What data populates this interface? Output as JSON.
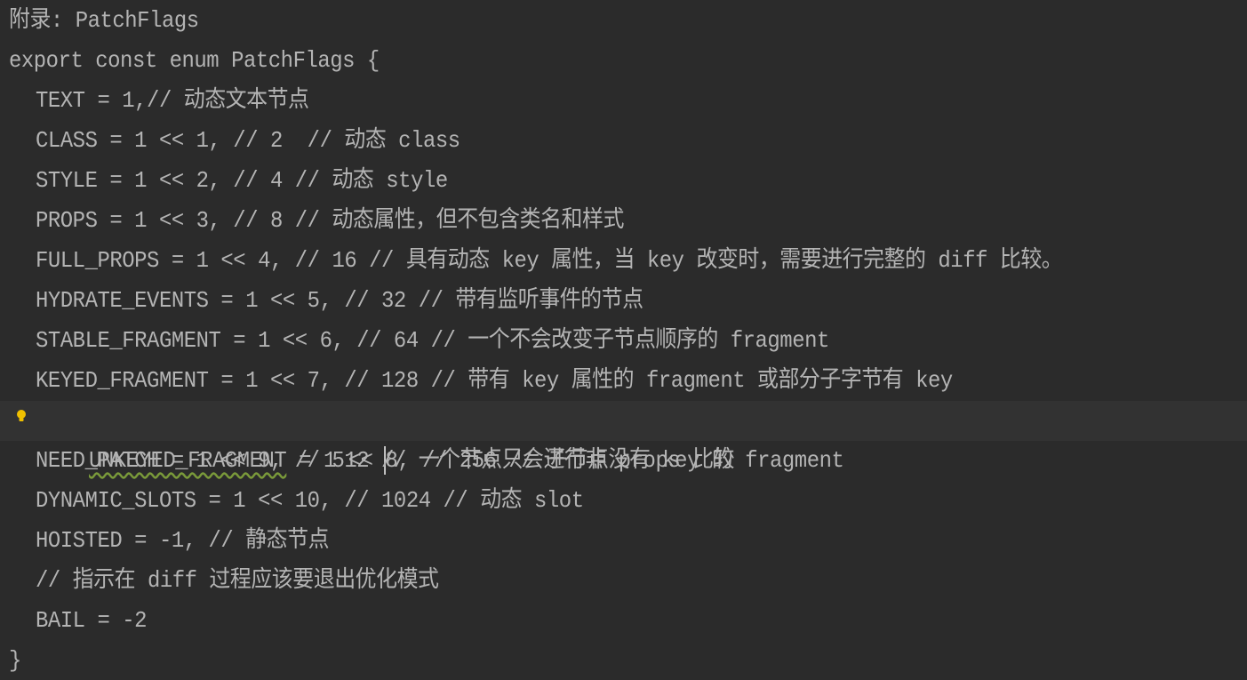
{
  "editor": {
    "lines": [
      {
        "text": "附录: PatchFlags"
      },
      {
        "text": "export const enum PatchFlags {"
      },
      {
        "text": "TEXT = 1,// 动态文本节点"
      },
      {
        "text": "CLASS = 1 << 1, // 2  // 动态 class"
      },
      {
        "text": "STYLE = 1 << 2, // 4 // 动态 style"
      },
      {
        "text": "PROPS = 1 << 3, // 8 // 动态属性，但不包含类名和样式"
      },
      {
        "text": "FULL_PROPS = 1 << 4, // 16 // 具有动态 key 属性，当 key 改变时，需要进行完整的 diff 比较。"
      },
      {
        "text": "HYDRATE_EVENTS = 1 << 5, // 32 // 带有监听事件的节点"
      },
      {
        "text": "STABLE_FRAGMENT = 1 << 6, // 64 // 一个不会改变子节点顺序的 fragment"
      },
      {
        "text": "KEYED_FRAGMENT = 1 << 7, // 128 // 带有 key 属性的 fragment 或部分子字节有 key"
      },
      {
        "name": "UNKEYED_FRAGMENT",
        "before_caret": " = 1 << ",
        "after_caret": "8, // 256 // 子节点没有 key 的 fragment"
      },
      {
        "text": "NEED_PATCH = 1 << 9, // 512 // 一个节点只会进行非 props 比较"
      },
      {
        "text": "DYNAMIC_SLOTS = 1 << 10, // 1024 // 动态 slot"
      },
      {
        "text": "HOISTED = -1, // 静态节点"
      },
      {
        "text": "// 指示在 diff 过程应该要退出优化模式"
      },
      {
        "text": "BAIL = -2"
      },
      {
        "text": "}"
      }
    ],
    "colors": {
      "background": "#2b2b2b",
      "text": "#b4b4b4",
      "current_line": "#323232",
      "bulb": "#f0c000"
    },
    "icons": {
      "gutter": "light-bulb-icon"
    }
  }
}
